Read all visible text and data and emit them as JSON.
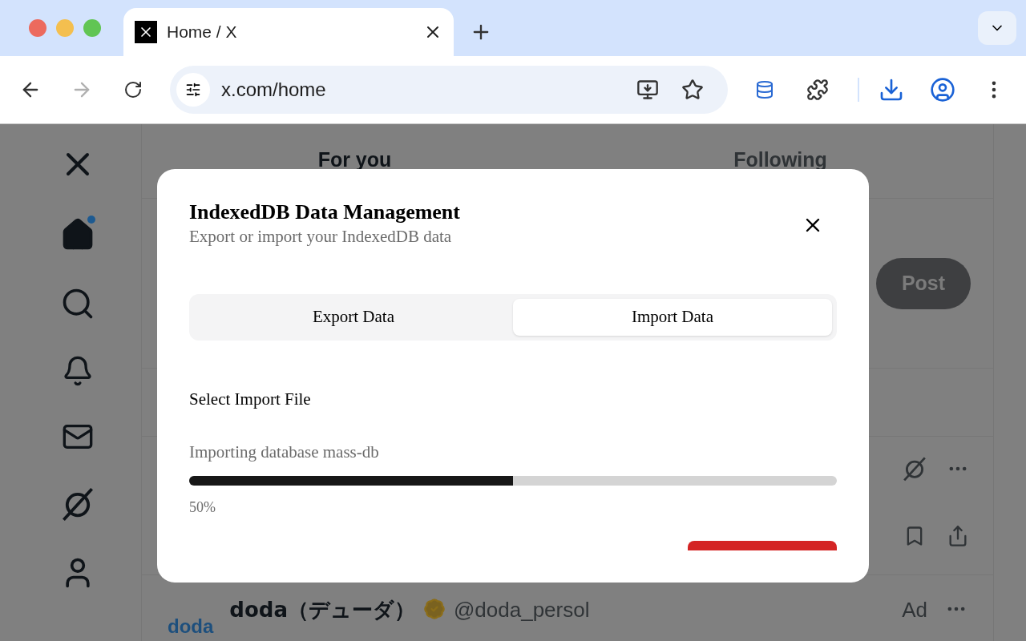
{
  "browser": {
    "tabs": [
      {
        "title": "Home / X",
        "selected": true
      }
    ],
    "address": "x.com/home"
  },
  "page": {
    "feed_tabs": [
      {
        "label": "For you",
        "selected": true
      },
      {
        "label": "Following",
        "selected": false
      }
    ],
    "post_button": "Post",
    "ad": {
      "logo": "doda",
      "name": "doda（デューダ）",
      "handle": "@doda_persol",
      "label": "Ad"
    }
  },
  "dialog": {
    "title": "IndexedDB Data Management",
    "subtitle": "Export or import your IndexedDB data",
    "tabs": [
      {
        "label": "Export Data",
        "selected": false
      },
      {
        "label": "Import Data",
        "selected": true
      }
    ],
    "section_label": "Select Import File",
    "status": "Importing database mass-db",
    "progress": {
      "level": 0.5,
      "reading": "50%"
    }
  }
}
